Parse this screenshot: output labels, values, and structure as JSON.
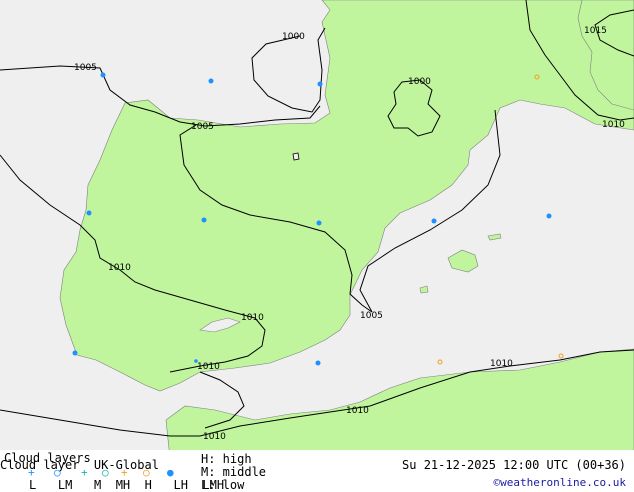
{
  "map": {
    "colors": {
      "sea": "#efefef",
      "land": "#c0f59d",
      "isobar": "#000000",
      "coast": "#7f7f7f"
    },
    "isobar_labels": [
      "1000",
      "1005",
      "1000",
      "1015",
      "1010",
      "1005",
      "1010",
      "1010",
      "1005",
      "1010",
      "1010",
      "1010",
      "1010"
    ],
    "markers": {
      "low_cloud": {
        "symbol": "filled-circle",
        "color": "#1e90ff",
        "count": 10
      },
      "middle_cloud": {
        "symbol": "open-circle",
        "color": "#f0a020",
        "count": 3
      }
    }
  },
  "footer": {
    "title": "Cloud layers",
    "subtitle": "Cloud layer  UK-Global",
    "layer_codes": "L   LM   M  MH  H   LH  LMH",
    "legend": {
      "high": "H: high",
      "middle": "M: middle",
      "low": "L: low"
    },
    "valid_time": "Su 21-12-2025 12:00 UTC (00+36)",
    "credit": "©weatheronline.co.uk"
  },
  "legend_symbols": [
    {
      "glyph": "+",
      "color": "#1e90ff"
    },
    {
      "glyph": "○",
      "color": "#1e90ff"
    },
    {
      "glyph": "+",
      "color": "#20b0b0"
    },
    {
      "glyph": "○",
      "color": "#20b0b0"
    },
    {
      "glyph": "+",
      "color": "#f0a020"
    },
    {
      "glyph": "○",
      "color": "#f0a020"
    },
    {
      "glyph": "●",
      "color": "#1e90ff"
    }
  ]
}
